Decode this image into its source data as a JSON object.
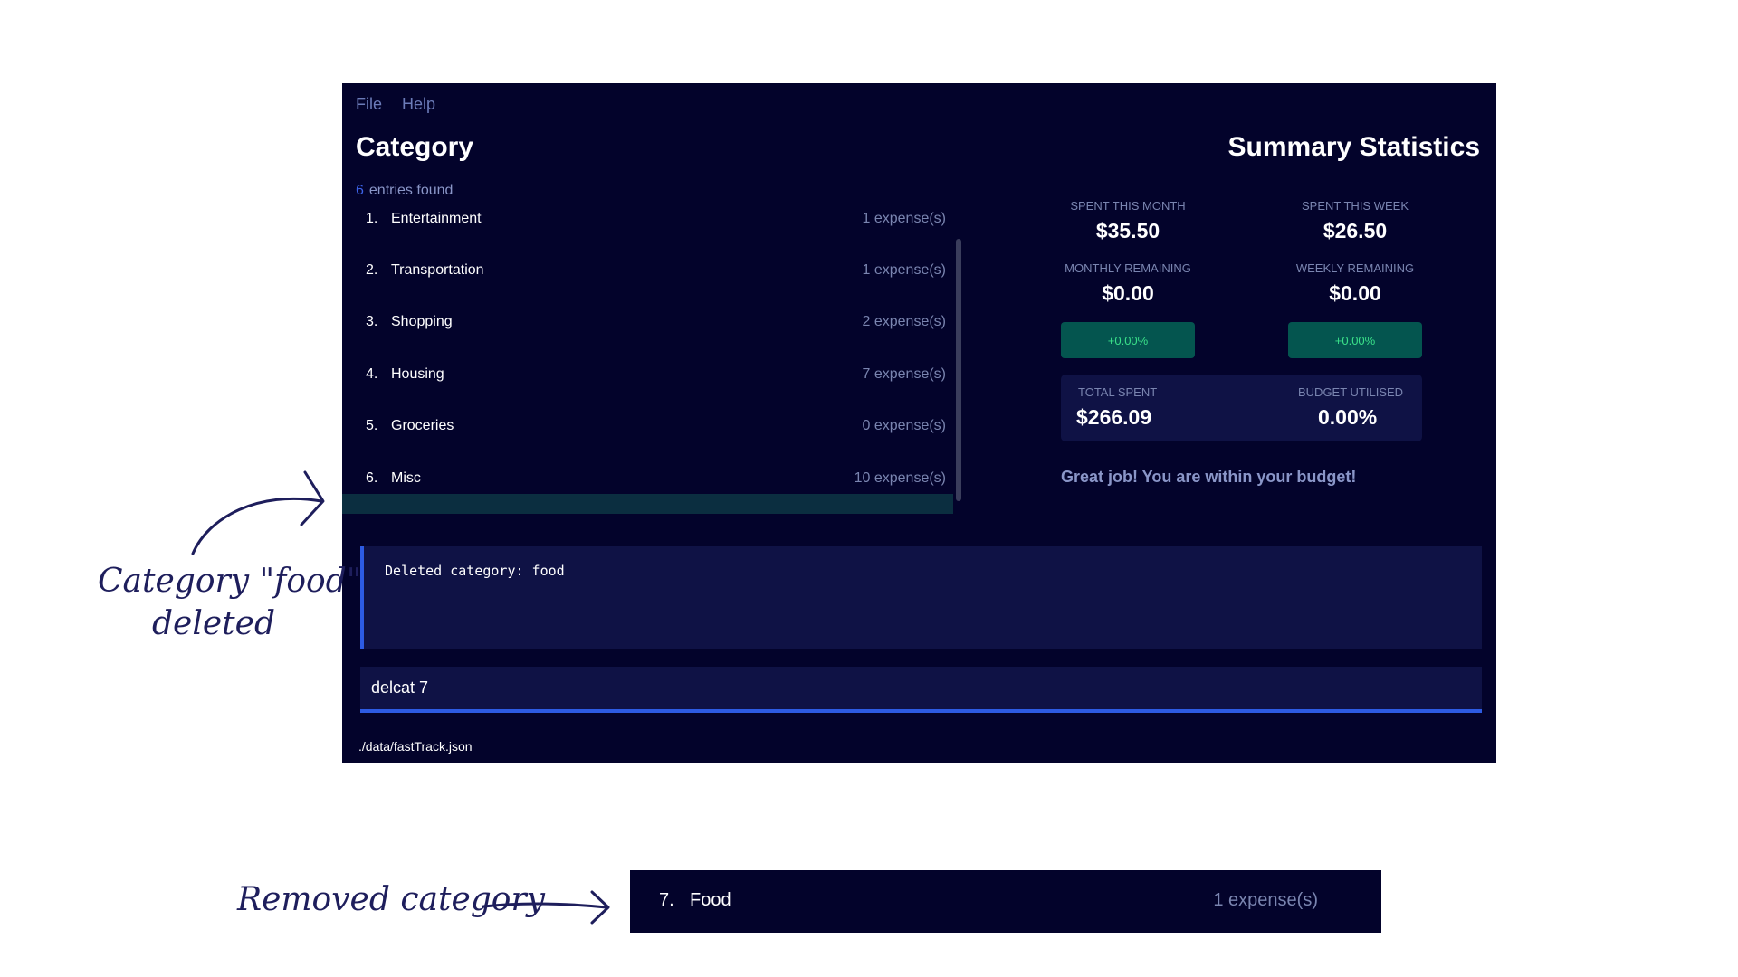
{
  "menu": {
    "file": "File",
    "help": "Help"
  },
  "category_panel": {
    "title": "Category",
    "entries_count": "6",
    "entries_label": "entries found",
    "items": [
      {
        "index": "1.",
        "name": "Entertainment",
        "expenses": "1 expense(s)"
      },
      {
        "index": "2.",
        "name": "Transportation",
        "expenses": "1 expense(s)"
      },
      {
        "index": "3.",
        "name": "Shopping",
        "expenses": "2 expense(s)"
      },
      {
        "index": "4.",
        "name": "Housing",
        "expenses": "7 expense(s)"
      },
      {
        "index": "5.",
        "name": "Groceries",
        "expenses": "0 expense(s)"
      },
      {
        "index": "6.",
        "name": "Misc",
        "expenses": "10 expense(s)"
      }
    ]
  },
  "summary": {
    "title": "Summary Statistics",
    "spent_month_label": "SPENT THIS MONTH",
    "spent_month_value": "$35.50",
    "spent_week_label": "SPENT THIS WEEK",
    "spent_week_value": "$26.50",
    "monthly_remaining_label": "MONTHLY REMAINING",
    "monthly_remaining_value": "$0.00",
    "weekly_remaining_label": "WEEKLY REMAINING",
    "weekly_remaining_value": "$0.00",
    "monthly_change": "+0.00%",
    "weekly_change": "+0.00%",
    "total_spent_label": "TOTAL SPENT",
    "total_spent_value": "$266.09",
    "budget_utilised_label": "BUDGET UTILISED",
    "budget_utilised_value": "0.00%",
    "message": "Great job! You are within your budget!"
  },
  "result_display": {
    "text": "Deleted category: food"
  },
  "command_box": {
    "value": "delcat 7"
  },
  "status_bar": {
    "path": "./data/fastTrack.json"
  },
  "annotations": {
    "deleted_line1": "Category \"food\"",
    "deleted_line2": "deleted",
    "removed": "Removed category"
  },
  "removed_category": {
    "index": "7.",
    "name": "Food",
    "expenses": "1 expense(s)"
  },
  "colors": {
    "background": "#03032b",
    "panel": "#0f1245",
    "accent": "#2d5be3",
    "positive": "#3ae089",
    "annotation": "#1e1e5c"
  }
}
